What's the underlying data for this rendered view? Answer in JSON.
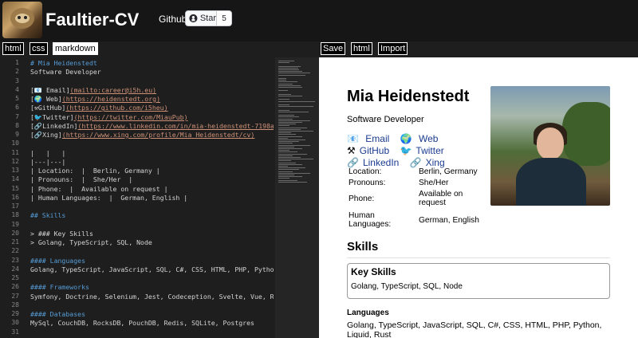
{
  "app": {
    "title": "Faultier-CV",
    "github_label": "Github",
    "star_label": "Star",
    "star_count": "5"
  },
  "left_buttons": [
    "html",
    "css",
    "markdown"
  ],
  "right_buttons": [
    "Save",
    "html",
    "Import"
  ],
  "editor": {
    "lines": [
      "# Mia Heidenstedt",
      "Software Developer",
      "",
      "[📧 Email](mailto:career@i5h.eu)",
      "[🌍 Web](https://heidenstedt.org)",
      "[⚒GitHub](https://github.com/i5heu)",
      "[🐦Twitter](https://twitter.com/MiauPub)",
      "[🔗LinkedIn](https://www.linkedin.com/in/mia-heidenstedt-7198ab145/",
      "[🔗Xing](https://www.xing.com/profile/Mia_Heidenstedt/cv)",
      "",
      "|   |   |",
      "|---|---|",
      "| Location:  |  Berlin, Germany |",
      "| Pronouns:  |  She/Her  |",
      "| Phone:  |  Available on request |",
      "| Human Languages:  |  German, English |",
      "",
      "## Skills",
      "",
      "> ### Key Skills",
      "> Golang, TypeScript, SQL, Node",
      "",
      "#### Languages",
      "Golang, TypeScript, JavaScript, SQL, C#, CSS, HTML, PHP, Python, Li",
      "",
      "#### Frameworks",
      "Symfony, Doctrine, Selenium, Jest, Codeception, Svelte, Vue, Redux",
      "",
      "#### Databases",
      "MySql, CouchDB, RocksDB, PouchDB, Redis, SQLite, Postgres",
      ""
    ]
  },
  "preview": {
    "name": "Mia Heidenstedt",
    "role": "Software Developer",
    "links": [
      {
        "icon": "📧",
        "label": "Email"
      },
      {
        "icon": "🌍",
        "label": "Web"
      },
      {
        "icon": "⚒",
        "label": "GitHub"
      },
      {
        "icon": "🐦",
        "label": "Twitter"
      },
      {
        "icon": "🔗",
        "label": "LinkedIn"
      },
      {
        "icon": "🔗",
        "label": "Xing"
      }
    ],
    "info": [
      {
        "key": "Location:",
        "value": "Berlin, Germany"
      },
      {
        "key": "Pronouns:",
        "value": "She/Her"
      },
      {
        "key": "Phone:",
        "value": "Available on request"
      },
      {
        "key": "Human Languages:",
        "value": "German, English"
      }
    ],
    "skills_heading": "Skills",
    "key_skills_heading": "Key Skills",
    "key_skills_text": "Golang, TypeScript, SQL, Node",
    "languages_heading": "Languages",
    "languages_text": "Golang, TypeScript, JavaScript, SQL, C#, CSS, HTML, PHP, Python, Liquid, Rust"
  },
  "colors": {
    "editor_bg": "#1e1e1e",
    "heading": "#569cd6",
    "link_url": "#ce9178",
    "link_underline": "#ce9178",
    "text": "#d4d4d4",
    "line_number": "#858585"
  }
}
